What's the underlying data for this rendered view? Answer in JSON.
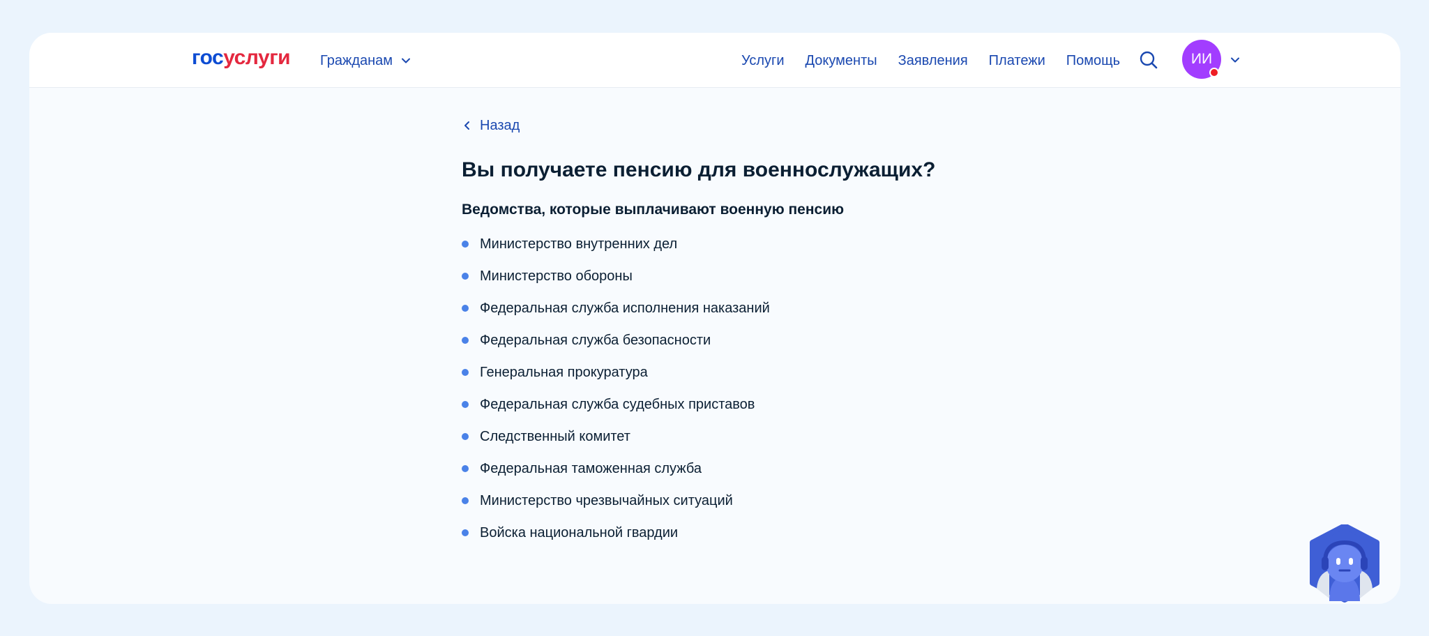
{
  "header": {
    "logo_part1": "гос",
    "logo_part2": "услуги",
    "citizens_label": "Гражданам",
    "nav": [
      "Услуги",
      "Документы",
      "Заявления",
      "Платежи",
      "Помощь"
    ],
    "avatar_initials": "ИИ"
  },
  "main": {
    "back_label": "Назад",
    "title": "Вы получаете пенсию для военнослужащих?",
    "subtitle": "Ведомства, которые выплачивают военную пенсию",
    "items": [
      "Министерство внутренних дел",
      "Министерство обороны",
      "Федеральная служба исполнения наказаний",
      "Федеральная служба безопасности",
      "Генеральная прокуратура",
      "Федеральная служба судебных приставов",
      "Следственный комитет",
      "Федеральная таможенная служба",
      "Министерство чрезвычайных ситуаций",
      "Войска национальной гвардии"
    ]
  },
  "colors": {
    "brand_blue": "#0d4cd3",
    "brand_red": "#e4283f",
    "link": "#1a48b0",
    "avatar": "#a23dff",
    "bullet": "#4a82e8"
  }
}
